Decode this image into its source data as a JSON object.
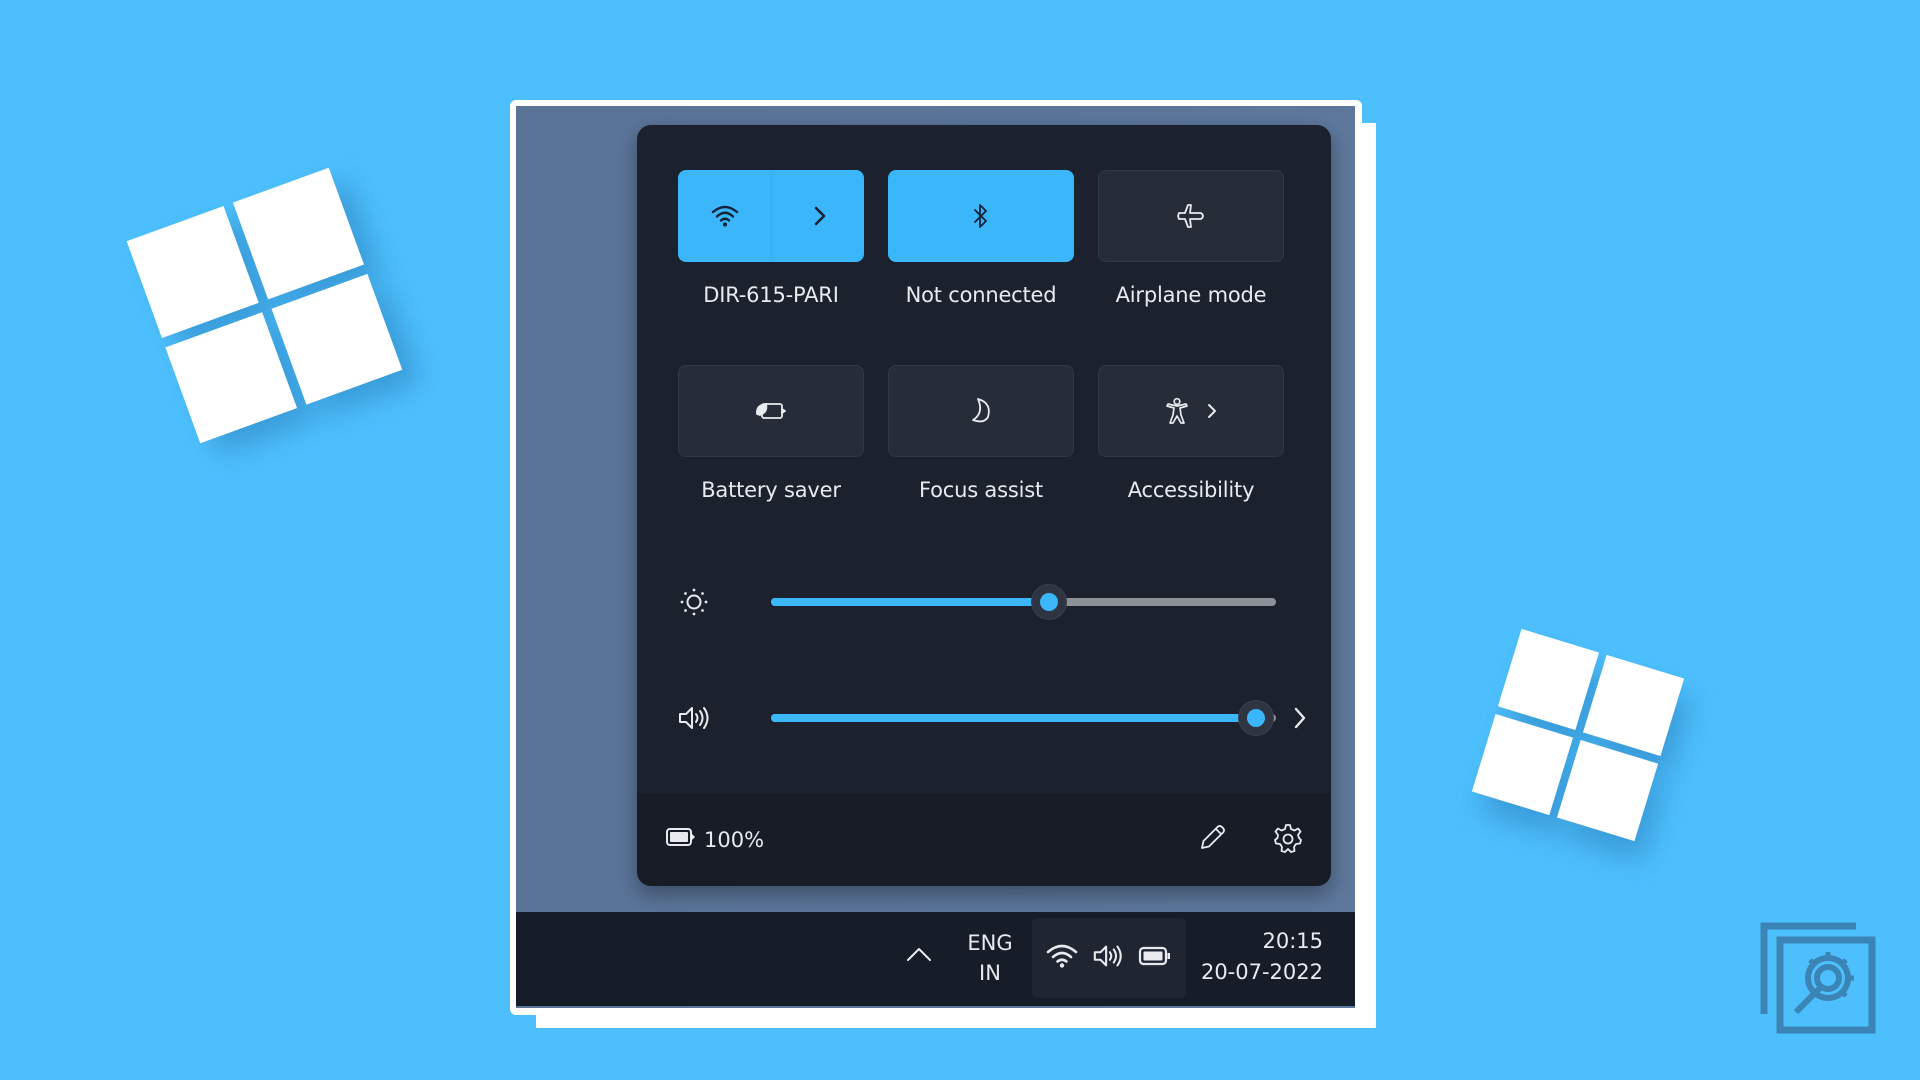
{
  "background_color": "#4dbffd",
  "accent_color": "#3bb6fa",
  "quick_settings": {
    "tiles": [
      {
        "id": "wifi",
        "label": "DIR-615-PARI",
        "icon": "wifi-icon",
        "active": true,
        "has_chevron": true
      },
      {
        "id": "bluetooth",
        "label": "Not connected",
        "icon": "bluetooth-icon",
        "active": true,
        "has_chevron": false
      },
      {
        "id": "airplane",
        "label": "Airplane mode",
        "icon": "airplane-icon",
        "active": false,
        "has_chevron": false
      },
      {
        "id": "battery-saver",
        "label": "Battery saver",
        "icon": "battery-saver-icon",
        "active": false,
        "has_chevron": false
      },
      {
        "id": "focus-assist",
        "label": "Focus assist",
        "icon": "moon-icon",
        "active": false,
        "has_chevron": false
      },
      {
        "id": "accessibility",
        "label": "Accessibility",
        "icon": "accessibility-icon",
        "active": false,
        "has_chevron": true
      }
    ],
    "brightness": {
      "icon": "sun-icon",
      "value_percent": 55
    },
    "volume": {
      "icon": "speaker-icon",
      "value_percent": 96
    },
    "footer": {
      "battery_icon": "battery-icon",
      "battery_text": "100%",
      "edit_icon": "pencil-icon",
      "settings_icon": "gear-icon"
    }
  },
  "taskbar": {
    "overflow_icon": "chevron-up-icon",
    "language_line1": "ENG",
    "language_line2": "IN",
    "tray_icons": [
      "wifi-icon",
      "speaker-icon",
      "battery-icon"
    ],
    "time": "20:15",
    "date": "20-07-2022"
  }
}
